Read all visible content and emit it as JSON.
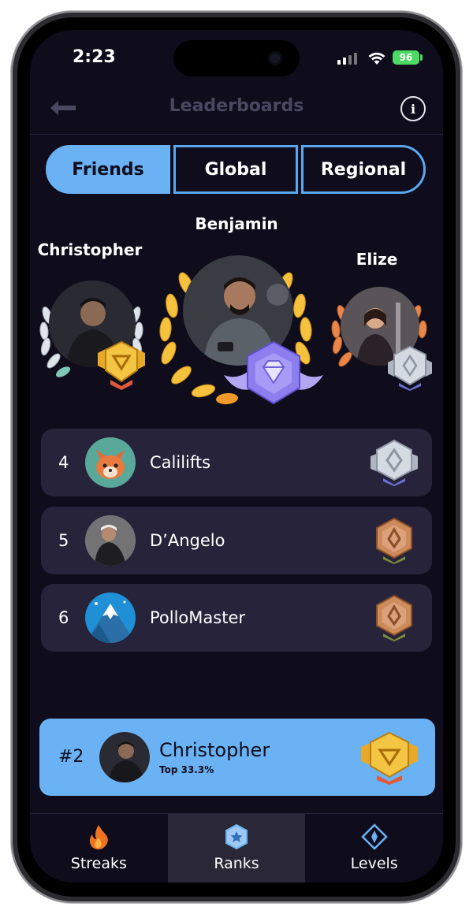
{
  "status_bar": {
    "time": "2:23",
    "battery": "96"
  },
  "header": {
    "title": "Leaderboards",
    "info_glyph": "i",
    "back_icon": "back-arrow-icon"
  },
  "tabs": [
    {
      "label": "Friends",
      "active": true
    },
    {
      "label": "Global",
      "active": false
    },
    {
      "label": "Regional",
      "active": false
    }
  ],
  "podium": {
    "first": {
      "name": "Benjamin",
      "badge": "diamond"
    },
    "second": {
      "name": "Christopher",
      "badge": "gold"
    },
    "third": {
      "name": "Elize",
      "badge": "silver"
    }
  },
  "leaderboard": [
    {
      "rank": "4",
      "name": "Calilifts",
      "badge": "silver"
    },
    {
      "rank": "5",
      "name": "D’Angelo",
      "badge": "bronze"
    },
    {
      "rank": "6",
      "name": "PolloMaster",
      "badge": "bronze"
    }
  ],
  "current_user": {
    "rank": "#2",
    "name": "Christopher",
    "subtitle": "Top 33.3%",
    "badge": "gold"
  },
  "nav": [
    {
      "label": "Streaks",
      "icon": "flame-icon",
      "active": false
    },
    {
      "label": "Ranks",
      "icon": "star-hexagon-icon",
      "active": true
    },
    {
      "label": "Levels",
      "icon": "diamond-compass-icon",
      "active": false
    }
  ],
  "colors": {
    "background": "#0f0c1c",
    "accent": "#6ab2f3",
    "row": "#26233a",
    "gold": "#f4c542",
    "silver": "#c9ccd6",
    "bronze": "#cd8a5a",
    "diamond": "#9b8cf0"
  }
}
